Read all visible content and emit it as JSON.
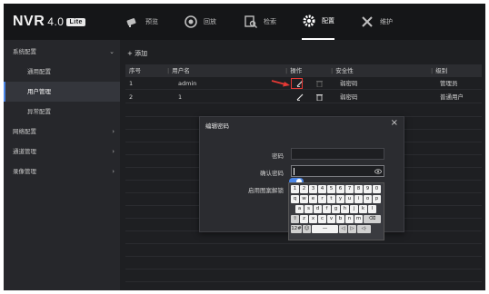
{
  "app": {
    "logo_text": "NVR",
    "version": "4.0",
    "badge": "Lite"
  },
  "topnav": [
    {
      "label": "预览",
      "icon": "camera-icon",
      "active": false
    },
    {
      "label": "回放",
      "icon": "playback-icon",
      "active": false
    },
    {
      "label": "检索",
      "icon": "search-icon",
      "active": false
    },
    {
      "label": "配置",
      "icon": "gear-icon",
      "active": true
    },
    {
      "label": "维护",
      "icon": "tools-icon",
      "active": false
    }
  ],
  "sidebar": {
    "items": [
      {
        "label": "系统配置",
        "level": "top",
        "arrow": "⌄"
      },
      {
        "label": "通用配置",
        "level": "sub"
      },
      {
        "label": "用户管理",
        "level": "sub",
        "selected": true
      },
      {
        "label": "异常配置",
        "level": "sub"
      },
      {
        "label": "网络配置",
        "level": "top",
        "arrow": "›"
      },
      {
        "label": "通道管理",
        "level": "top",
        "arrow": "›"
      },
      {
        "label": "录像管理",
        "level": "top",
        "arrow": "›"
      }
    ]
  },
  "main": {
    "add_label": "+ 添加",
    "columns": [
      "序号",
      "用户名",
      "操作",
      "安全性",
      "级别"
    ],
    "rows": [
      {
        "index": "1",
        "username": "admin",
        "security": "弱密码",
        "level": "管理员"
      },
      {
        "index": "2",
        "username": "1",
        "security": "弱密码",
        "level": "普通用户"
      }
    ]
  },
  "modal": {
    "title": "编辑密码",
    "close": "×",
    "password_label": "密码",
    "password_value": "",
    "confirm_label": "确认密码",
    "confirm_value": "",
    "pattern_label": "启用图案解锁",
    "pattern_enabled": true
  },
  "keyboard": {
    "row1": [
      "1",
      "2",
      "3",
      "4",
      "5",
      "6",
      "7",
      "8",
      "9",
      "0"
    ],
    "row2": [
      "q",
      "w",
      "e",
      "r",
      "t",
      "y",
      "u",
      "i",
      "o",
      "p"
    ],
    "row3": [
      "a",
      "s",
      "d",
      "f",
      "g",
      "h",
      "j",
      "k",
      "l"
    ],
    "row4": [
      "⇧",
      "z",
      "x",
      "c",
      "v",
      "b",
      "n",
      "m",
      "⌫"
    ],
    "row5": [
      "12#",
      "☺",
      "—",
      "◁",
      "▷",
      "◁·"
    ]
  },
  "colors": {
    "accent": "#4a86e8",
    "highlight": "#e53935",
    "background": "#1e1f22",
    "topbar": "#151618"
  }
}
